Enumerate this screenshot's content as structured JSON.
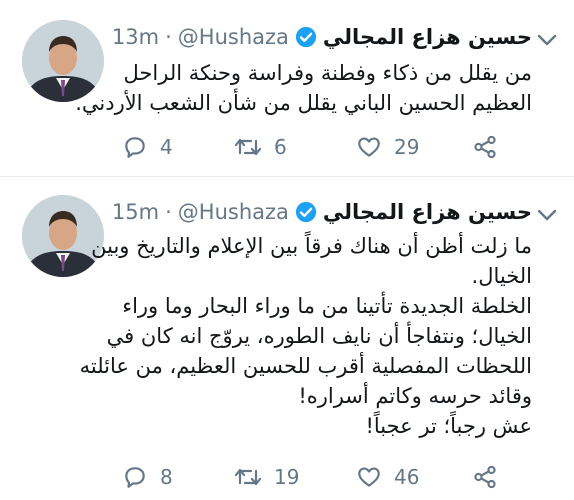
{
  "tweets": [
    {
      "author": {
        "name": "حسين هزاع المجالي",
        "handle": "@Hushaza"
      },
      "separator": "·",
      "time": "13m",
      "text_lines": [
        "من يقلل من ذكاء وفطنة وفراسة وحنكة الراحل",
        "العظيم الحسين الباني يقلل من شأن الشعب الأردني."
      ],
      "actions": {
        "replies": "4",
        "retweets": "6",
        "likes": "29"
      }
    },
    {
      "author": {
        "name": "حسين هزاع المجالي",
        "handle": "@Hushaza"
      },
      "separator": "·",
      "time": "15m",
      "text_lines": [
        "ما زلت أظن أن هناك فرقاً بين الإعلام والتاريخ وبين",
        "الخيال.",
        "الخلطة الجديدة تأتينا من ما وراء البحار وما وراء",
        "الخيال؛ ونتفاجأ  أن نايف الطوره، يروّج انه كان في",
        "اللحظات المفصلية أقرب للحسين العظيم، من عائلته",
        "وقائد حرسه وكاتم أسراره!",
        "عش رجباً؛ تر عجباً!"
      ],
      "actions": {
        "replies": "8",
        "retweets": "19",
        "likes": "46"
      }
    }
  ],
  "icons": {
    "reply": "reply-icon",
    "retweet": "retweet-icon",
    "like": "heart-icon",
    "share": "share-icon",
    "verified": "verified-badge-icon",
    "menu": "chevron-down-icon"
  },
  "colors": {
    "verified": "#1da1f2",
    "secondary": "#657786",
    "text": "#14171a",
    "divider": "#e6ecf0"
  }
}
